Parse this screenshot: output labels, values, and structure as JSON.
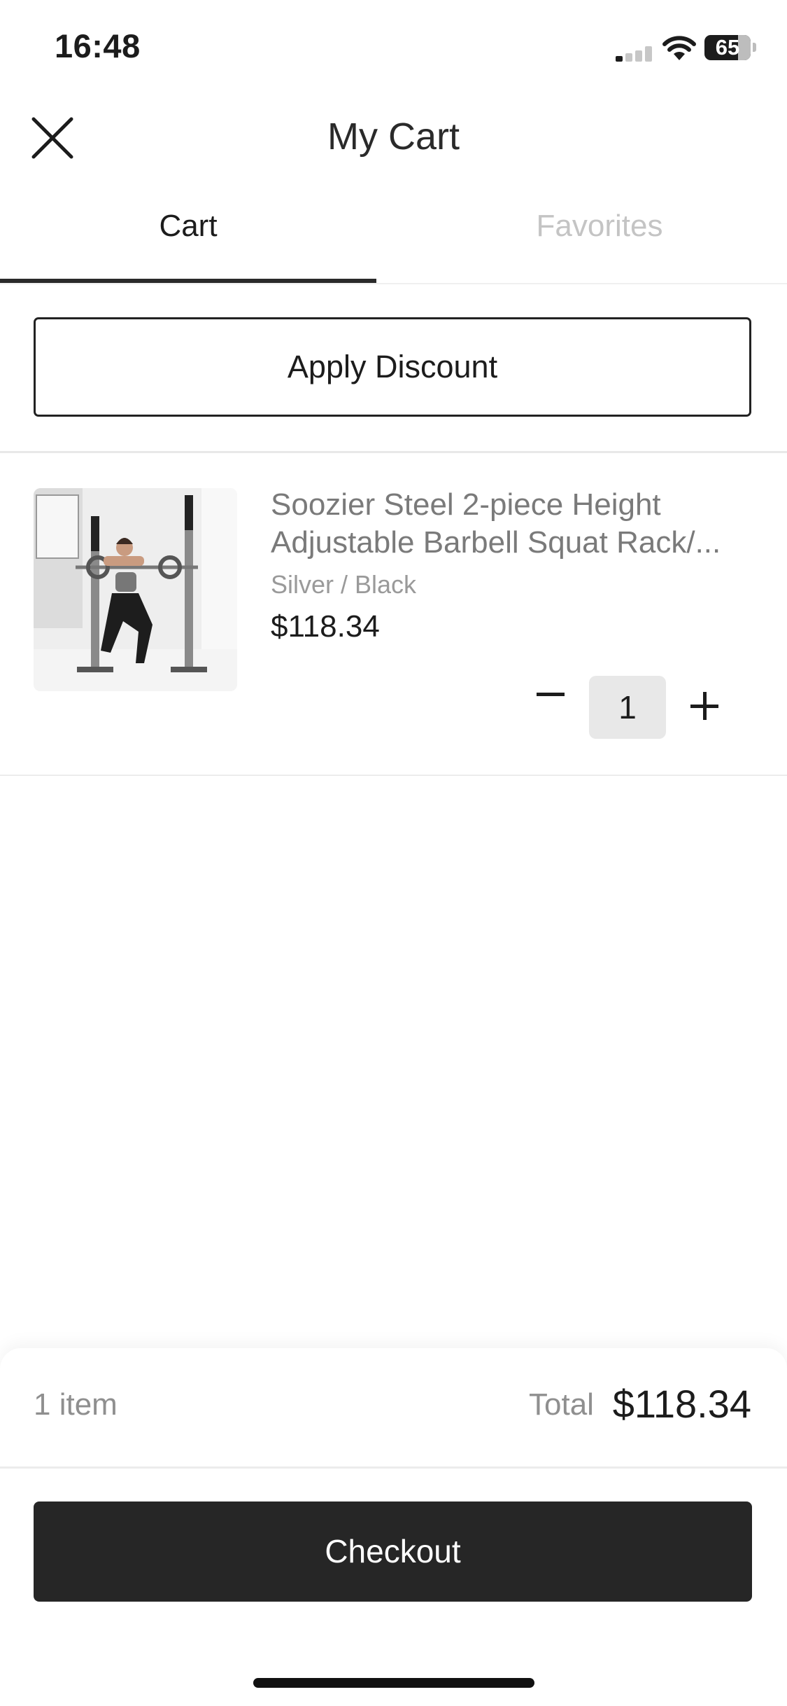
{
  "status_bar": {
    "time": "16:48",
    "battery": "65"
  },
  "header": {
    "title": "My Cart",
    "close_icon": "close-icon"
  },
  "tabs": [
    {
      "label": "Cart",
      "active": true
    },
    {
      "label": "Favorites",
      "active": false
    }
  ],
  "discount": {
    "label": "Apply Discount"
  },
  "cart_items": [
    {
      "name": "Soozier Steel 2-piece Height Adjustable Barbell Squat Rack/...",
      "variant": "Silver / Black",
      "price": "$118.34",
      "quantity": "1"
    }
  ],
  "summary": {
    "item_count": "1 item",
    "total_label": "Total",
    "total_value": "$118.34"
  },
  "checkout": {
    "label": "Checkout"
  },
  "colors": {
    "primary": "#262626",
    "muted_text": "#8f8f8f",
    "inactive_tab": "#c4c4c4"
  }
}
